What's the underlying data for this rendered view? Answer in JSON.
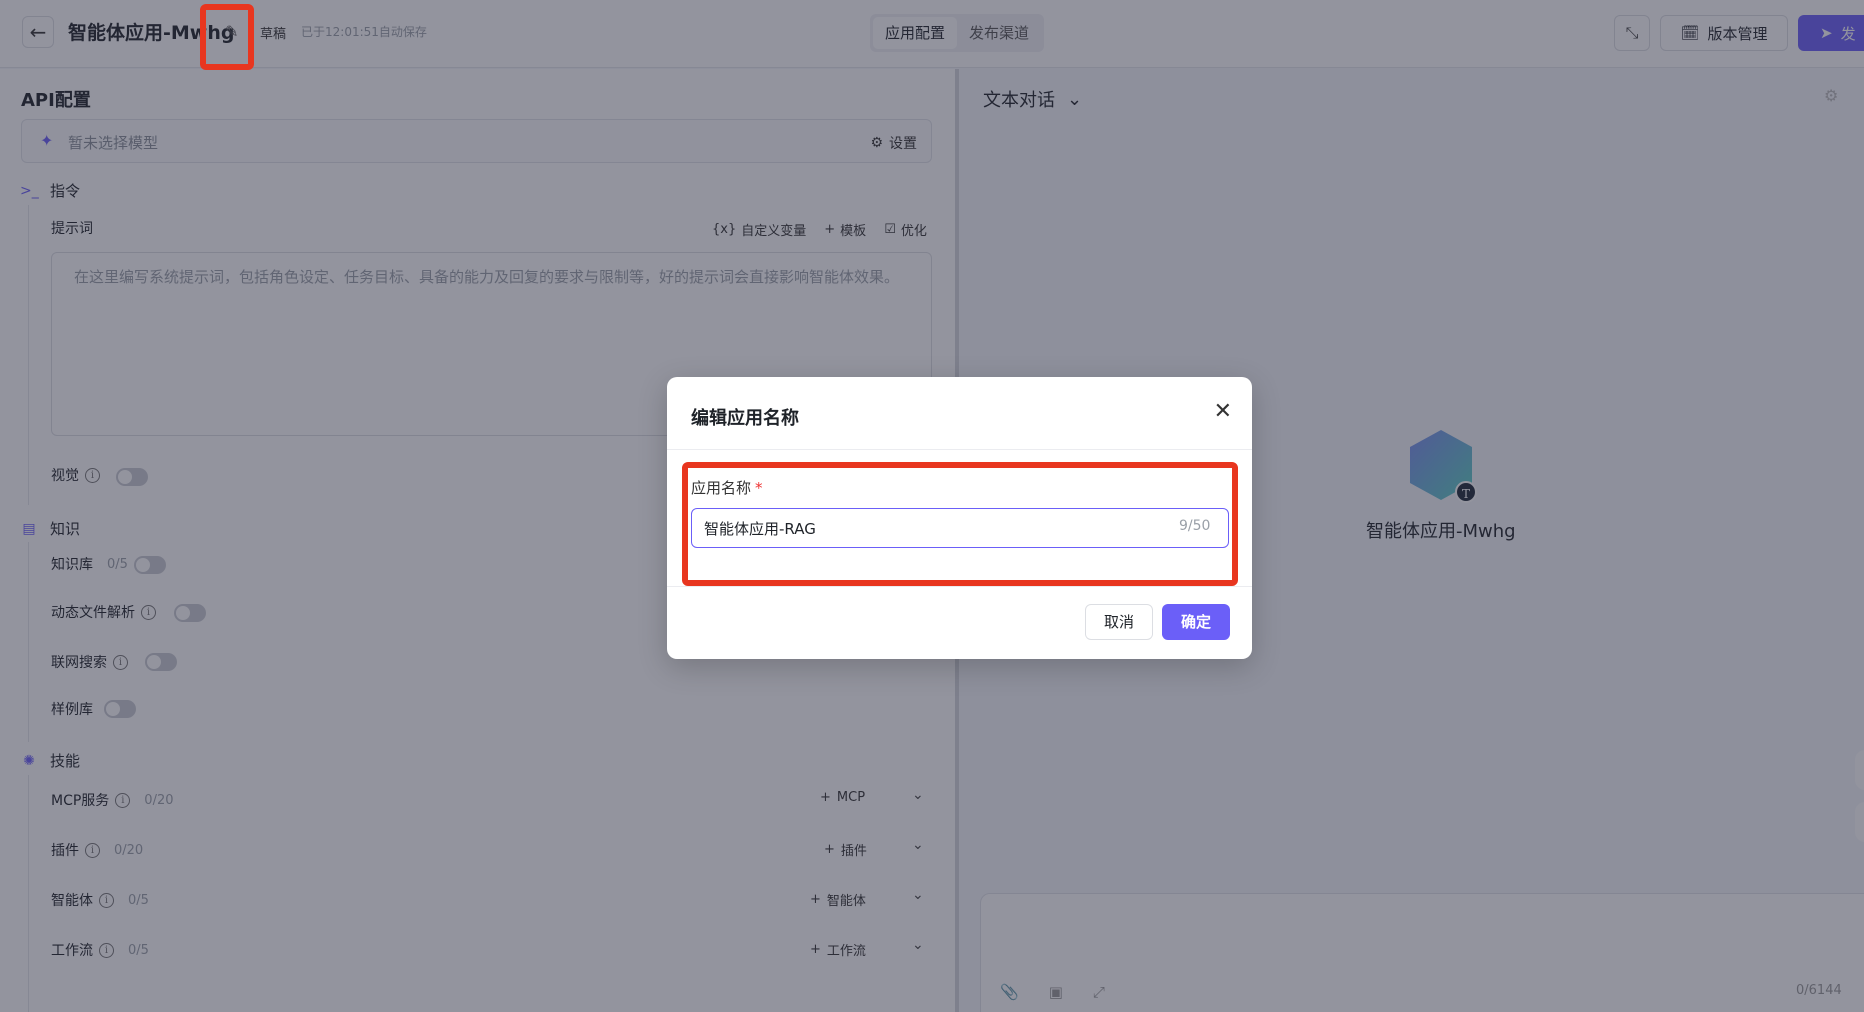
{
  "header": {
    "app_title": "智能体应用-Mwhg",
    "draft": "草稿",
    "autosave": "已于12:01:51自动保存",
    "tabs": [
      {
        "label": "应用配置",
        "active": true
      },
      {
        "label": "发布渠道",
        "active": false
      }
    ],
    "version_label": "版本管理",
    "publish_label": "发"
  },
  "left": {
    "section_title": "API配置",
    "model_placeholder": "暂未选择模型",
    "model_settings": "设置",
    "instruction": {
      "title": "指令",
      "prompt_label": "提示词",
      "custom_var": "自定义变量",
      "template": "模板",
      "optimize": "优化",
      "prompt_placeholder": "在这里编写系统提示词，包括角色设定、任务目标、具备的能力及回复的要求与限制等，好的提示词会直接影响智能体效果。",
      "vision": "视觉"
    },
    "knowledge": {
      "title": "知识",
      "kb": "知识库",
      "kb_count": "0/5",
      "dynamic_file": "动态文件解析",
      "web_search": "联网搜索",
      "examples": "样例库"
    },
    "skills": {
      "title": "技能",
      "mcp": "MCP服务",
      "mcp_count": "0/20",
      "mcp_add": "MCP",
      "plugin": "插件",
      "plugin_count": "0/20",
      "plugin_add": "插件",
      "agent": "智能体",
      "agent_count": "0/5",
      "agent_add": "智能体",
      "workflow": "工作流",
      "workflow_count": "0/5",
      "workflow_add": "工作流"
    }
  },
  "right": {
    "mode": "文本对话",
    "agent_name": "智能体应用-Mwhg",
    "agent_badge": "T",
    "char_count": "0/6144"
  },
  "modal": {
    "title": "编辑应用名称",
    "field_label": "应用名称",
    "required_mark": "*",
    "input_value": "智能体应用-RAG",
    "input_count": "9/50",
    "cancel": "取消",
    "confirm": "确定"
  },
  "colors": {
    "accent": "#6b5ff8",
    "annotation": "#e8361f"
  }
}
